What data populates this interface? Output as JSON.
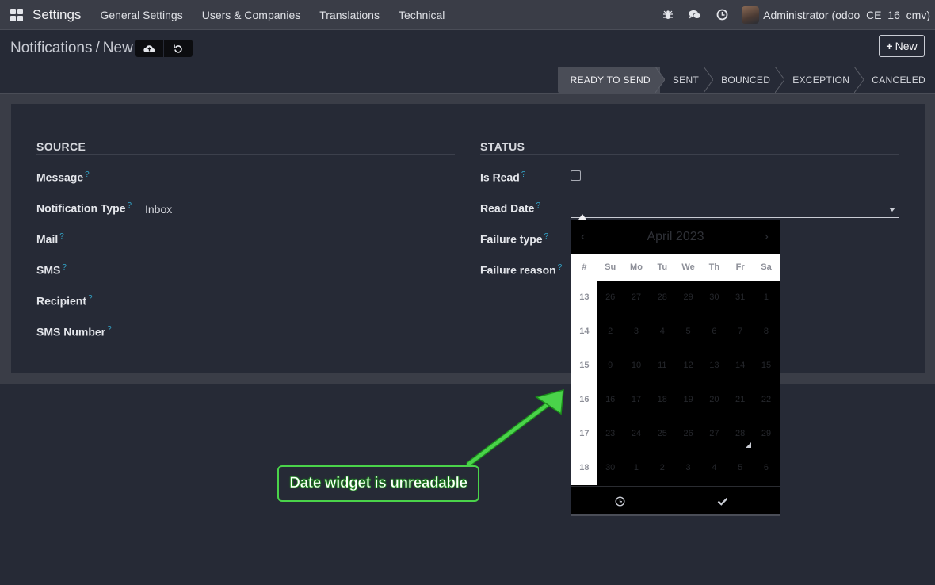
{
  "navbar": {
    "app_name": "Settings",
    "menu": [
      "General Settings",
      "Users & Companies",
      "Translations",
      "Technical"
    ],
    "user": "Administrator (odoo_CE_16_cmv)",
    "icons": [
      "apps-icon",
      "bug-icon",
      "chat-icon",
      "clock-icon"
    ]
  },
  "control_panel": {
    "breadcrumb_parent": "Notifications",
    "breadcrumb_sep": "/",
    "breadcrumb_current": "New",
    "new_button": "New"
  },
  "statusbar": {
    "stages": [
      "READY TO SEND",
      "SENT",
      "BOUNCED",
      "EXCEPTION",
      "CANCELED"
    ],
    "active_stage": "READY TO SEND"
  },
  "form": {
    "source": {
      "title": "SOURCE",
      "fields": [
        {
          "label": "Message",
          "value": ""
        },
        {
          "label": "Notification Type",
          "value": "Inbox"
        },
        {
          "label": "Mail",
          "value": ""
        },
        {
          "label": "SMS",
          "value": ""
        },
        {
          "label": "Recipient",
          "value": ""
        },
        {
          "label": "SMS Number",
          "value": ""
        }
      ]
    },
    "status": {
      "title": "STATUS",
      "fields": [
        {
          "label": "Is Read",
          "value": false
        },
        {
          "label": "Read Date",
          "value": ""
        },
        {
          "label": "Failure type",
          "value": ""
        },
        {
          "label": "Failure reason",
          "value": ""
        }
      ]
    },
    "help_mark": "?"
  },
  "datepicker": {
    "month_label": "April 2023",
    "prev": "‹",
    "next": "›",
    "week_header": "#",
    "days": [
      "Su",
      "Mo",
      "Tu",
      "We",
      "Th",
      "Fr",
      "Sa"
    ],
    "weeks": [
      {
        "wk": "13",
        "days": [
          "26",
          "27",
          "28",
          "29",
          "30",
          "31",
          "1"
        ]
      },
      {
        "wk": "14",
        "days": [
          "2",
          "3",
          "4",
          "5",
          "6",
          "7",
          "8"
        ]
      },
      {
        "wk": "15",
        "days": [
          "9",
          "10",
          "11",
          "12",
          "13",
          "14",
          "15"
        ]
      },
      {
        "wk": "16",
        "days": [
          "16",
          "17",
          "18",
          "19",
          "20",
          "21",
          "22"
        ]
      },
      {
        "wk": "17",
        "days": [
          "23",
          "24",
          "25",
          "26",
          "27",
          "28",
          "29"
        ]
      },
      {
        "wk": "18",
        "days": [
          "30",
          "1",
          "2",
          "3",
          "4",
          "5",
          "6"
        ]
      }
    ],
    "today": "28"
  },
  "annotation": {
    "text": "Date widget is unreadable",
    "color": "#4ad34a"
  }
}
